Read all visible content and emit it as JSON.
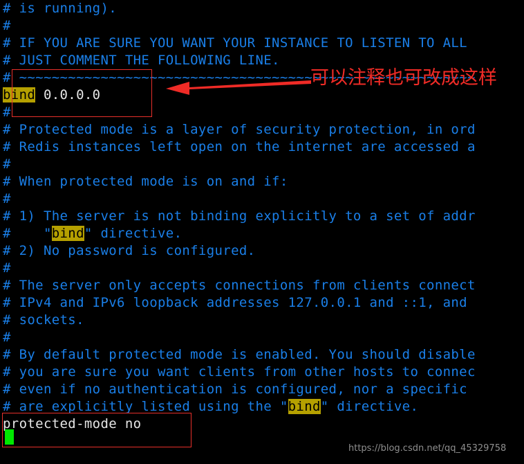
{
  "window": {
    "kind": "terminal-text-editor",
    "background_color": "#000000",
    "comment_color": "#1a7fe8",
    "value_color": "#e6e6e6",
    "highlight_bg_color": "#b5a000",
    "highlight_fg_color": "#000000",
    "annotation_color": "#ef2b26",
    "cursor_color": "#00e800"
  },
  "file": {
    "lines": [
      {
        "id": "l01",
        "text": "# is running).",
        "type": "comment"
      },
      {
        "id": "l02",
        "text": "#",
        "type": "comment"
      },
      {
        "id": "l03",
        "text": "# IF YOU ARE SURE YOU WANT YOUR INSTANCE TO LISTEN TO ALL",
        "type": "comment"
      },
      {
        "id": "l04",
        "text": "# JUST COMMENT THE FOLLOWING LINE.",
        "type": "comment"
      },
      {
        "id": "l05",
        "text": "# ~~~~~~~~~~~~~~~~~~~~~~~~~~~~~~~~~~~~~~~~~~~~~~~~~~~~~~~~",
        "type": "comment"
      },
      {
        "id": "l06",
        "text": "bind 0.0.0.0",
        "type": "directive",
        "keyword": "bind",
        "value": " 0.0.0.0"
      },
      {
        "id": "l07",
        "text": "#",
        "type": "comment"
      },
      {
        "id": "l08",
        "text": "# Protected mode is a layer of security protection, in ord",
        "type": "comment"
      },
      {
        "id": "l09",
        "text": "# Redis instances left open on the internet are accessed a",
        "type": "comment"
      },
      {
        "id": "l10",
        "text": "#",
        "type": "comment"
      },
      {
        "id": "l11",
        "text": "# When protected mode is on and if:",
        "type": "comment"
      },
      {
        "id": "l12",
        "text": "#",
        "type": "comment"
      },
      {
        "id": "l13",
        "text": "# 1) The server is not binding explicitly to a set of addr",
        "type": "comment"
      },
      {
        "id": "l14",
        "text": "#    \"bind\" directive.",
        "type": "comment-with-highlight",
        "prefix": "#    \"",
        "keyword": "bind",
        "suffix": "\" directive."
      },
      {
        "id": "l15",
        "text": "# 2) No password is configured.",
        "type": "comment"
      },
      {
        "id": "l16",
        "text": "#",
        "type": "comment"
      },
      {
        "id": "l17",
        "text": "# The server only accepts connections from clients connect",
        "type": "comment"
      },
      {
        "id": "l18",
        "text": "# IPv4 and IPv6 loopback addresses 127.0.0.1 and ::1, and",
        "type": "comment"
      },
      {
        "id": "l19",
        "text": "# sockets.",
        "type": "comment"
      },
      {
        "id": "l20",
        "text": "#",
        "type": "comment"
      },
      {
        "id": "l21",
        "text": "# By default protected mode is enabled. You should disable",
        "type": "comment"
      },
      {
        "id": "l22",
        "text": "# you are sure you want clients from other hosts to connec",
        "type": "comment"
      },
      {
        "id": "l23",
        "text": "# even if no authentication is configured, nor a specific",
        "type": "comment"
      },
      {
        "id": "l24",
        "text": "# are explicitly listed using the \"bind\" directive.",
        "type": "comment-with-highlight",
        "prefix": "# are explicitly listed using the \"",
        "keyword": "bind",
        "suffix": "\" directive."
      },
      {
        "id": "l25",
        "text": "protected-mode no",
        "type": "directive-plain"
      }
    ]
  },
  "annotations": {
    "arrow_label": "red-left-arrow",
    "note_text": "可以注释也可改成这样",
    "bind_box_label": "bind-line-highlight-box",
    "protected_box_label": "protected-mode-line-highlight-box"
  },
  "watermark": {
    "text": "https://blog.csdn.net/qq_45329758"
  }
}
